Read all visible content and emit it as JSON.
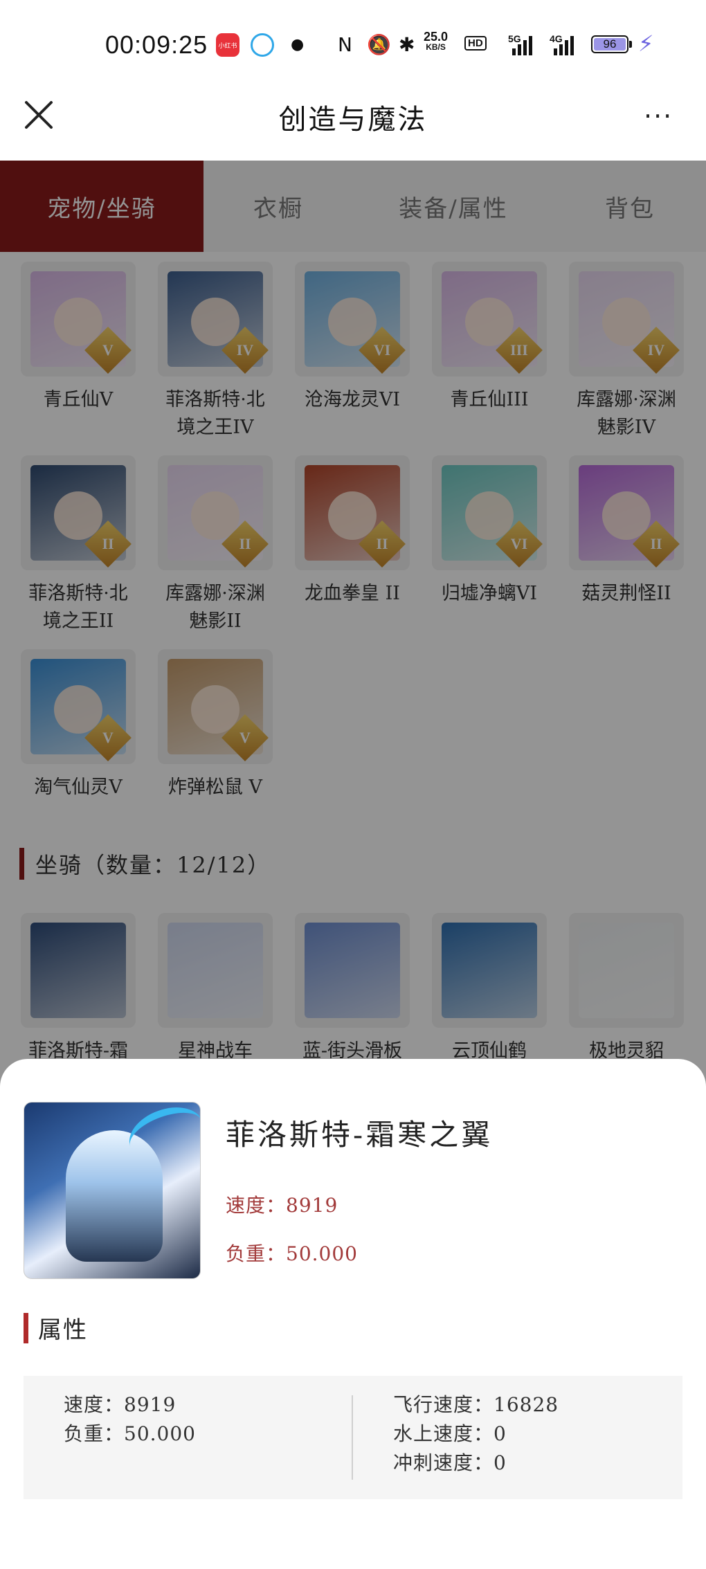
{
  "status_bar": {
    "time": "00:09:25",
    "app_badge": "小红书",
    "net_speed_value": "25.0",
    "net_speed_unit": "KB/S",
    "hd_label": "HD",
    "sig1_label": "5G",
    "sig2_label": "4G",
    "battery": "96"
  },
  "nav": {
    "title": "创造与魔法",
    "more_label": "···"
  },
  "tabs": [
    {
      "label": "宠物/坐骑",
      "active": true
    },
    {
      "label": "衣橱",
      "active": false
    },
    {
      "label": "装备/属性",
      "active": false
    },
    {
      "label": "背包",
      "active": false
    }
  ],
  "pets": [
    {
      "name": "青丘仙V",
      "rank": "V",
      "color": "#d9b8e6"
    },
    {
      "name": "菲洛斯特·北境之王IV",
      "rank": "IV",
      "color": "#3d5f8f"
    },
    {
      "name": "沧海龙灵VI",
      "rank": "VI",
      "color": "#6fb0e0"
    },
    {
      "name": "青丘仙III",
      "rank": "III",
      "color": "#d9b8e6"
    },
    {
      "name": "库露娜·深渊魅影IV",
      "rank": "IV",
      "color": "#e8d8f0"
    },
    {
      "name": "菲洛斯特·北境之王II",
      "rank": "II",
      "color": "#2f4a70"
    },
    {
      "name": "库露娜·深渊魅影II",
      "rank": "II",
      "color": "#ead9f2"
    },
    {
      "name": "龙血拳皇 II",
      "rank": "II",
      "color": "#b2452a"
    },
    {
      "name": "归墟净螭VI",
      "rank": "VI",
      "color": "#6ec8c2"
    },
    {
      "name": "菇灵荆怪II",
      "rank": "II",
      "color": "#b66ad8"
    },
    {
      "name": "淘气仙灵V",
      "rank": "V",
      "color": "#3a8fd6"
    },
    {
      "name": "炸弹松鼠 V",
      "rank": "V",
      "color": "#c49a6a"
    }
  ],
  "mounts_section": {
    "title": "坐骑（数量：12/12）"
  },
  "mounts": [
    {
      "name": "菲洛斯特-霜",
      "color": "#2e4c7a"
    },
    {
      "name": "星神战车",
      "color": "#cfd8ef"
    },
    {
      "name": "蓝-街头滑板",
      "color": "#6e8ed0"
    },
    {
      "name": "云顶仙鹤",
      "color": "#2f6fb0"
    },
    {
      "name": "极地灵貂",
      "color": "#eef1f2"
    }
  ],
  "detail": {
    "name": "菲洛斯特-霜寒之翼",
    "speed": "速度：8919",
    "load": "负重：50.000",
    "attr_title": "属性",
    "attrs_left": [
      "速度：8919",
      "负重：50.000"
    ],
    "attrs_right": [
      "飞行速度：16828",
      "水上速度：0",
      "冲刺速度：0"
    ]
  },
  "colors": {
    "accent": "#8b1a1a",
    "stat_red": "#a23a3a",
    "battery": "#9b95e6"
  }
}
